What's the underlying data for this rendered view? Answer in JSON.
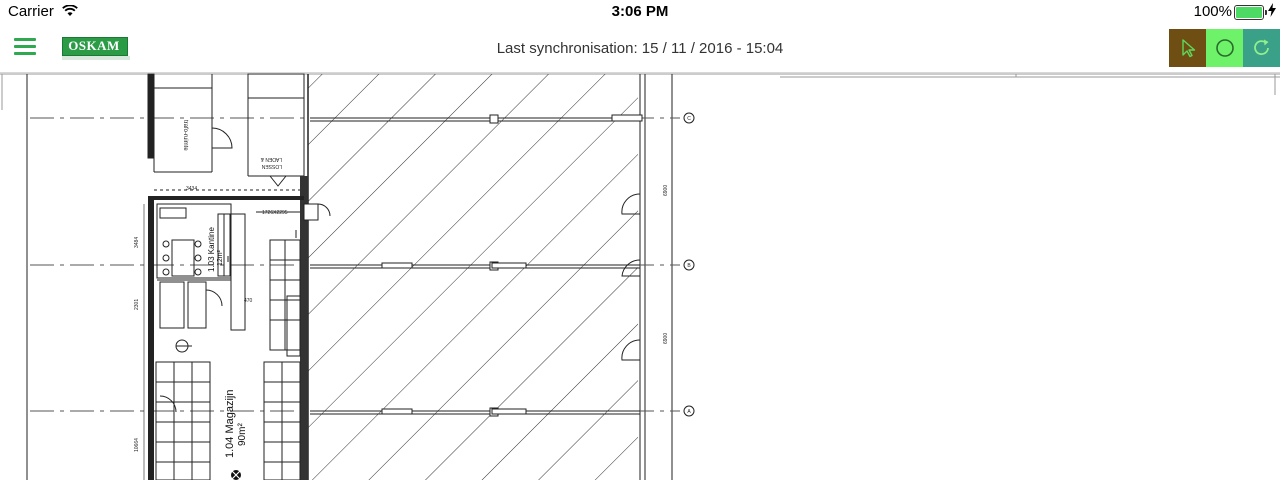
{
  "status_bar": {
    "carrier": "Carrier",
    "time": "3:06 PM",
    "battery_percent": "100%"
  },
  "header": {
    "logo_text": "OSKAM",
    "sync_text": "Last synchronisation: 15 / 11 / 2016 - 15:04",
    "tools": [
      {
        "name": "pointer-tool",
        "icon": "cursor-arrow-icon",
        "color": "#6e4e12"
      },
      {
        "name": "circle-tool",
        "icon": "circle-icon",
        "color": "#6ef26a"
      },
      {
        "name": "redo-tool",
        "icon": "redo-icon",
        "color": "#3aa087"
      }
    ]
  },
  "floorplan": {
    "rooms": {
      "trafo": "trafo-ruimte",
      "laden_line1": "LADEN &",
      "laden_line2": "LOSSEN",
      "kantine_line1": "1.03 Kantine",
      "kantine_line2": "12m²",
      "magazijn_line1": "1.04 Magazijn",
      "magazijn_line2": "90m²"
    },
    "dimensions": [
      "3484",
      "2301",
      "10664",
      "470",
      "6900",
      "6900",
      "3434",
      "1726X2295"
    ],
    "grid_markers": [
      "C",
      "B",
      "A"
    ],
    "colors": {
      "line": "#222222",
      "grid": "#555555",
      "accent": "#2b9b46"
    }
  }
}
